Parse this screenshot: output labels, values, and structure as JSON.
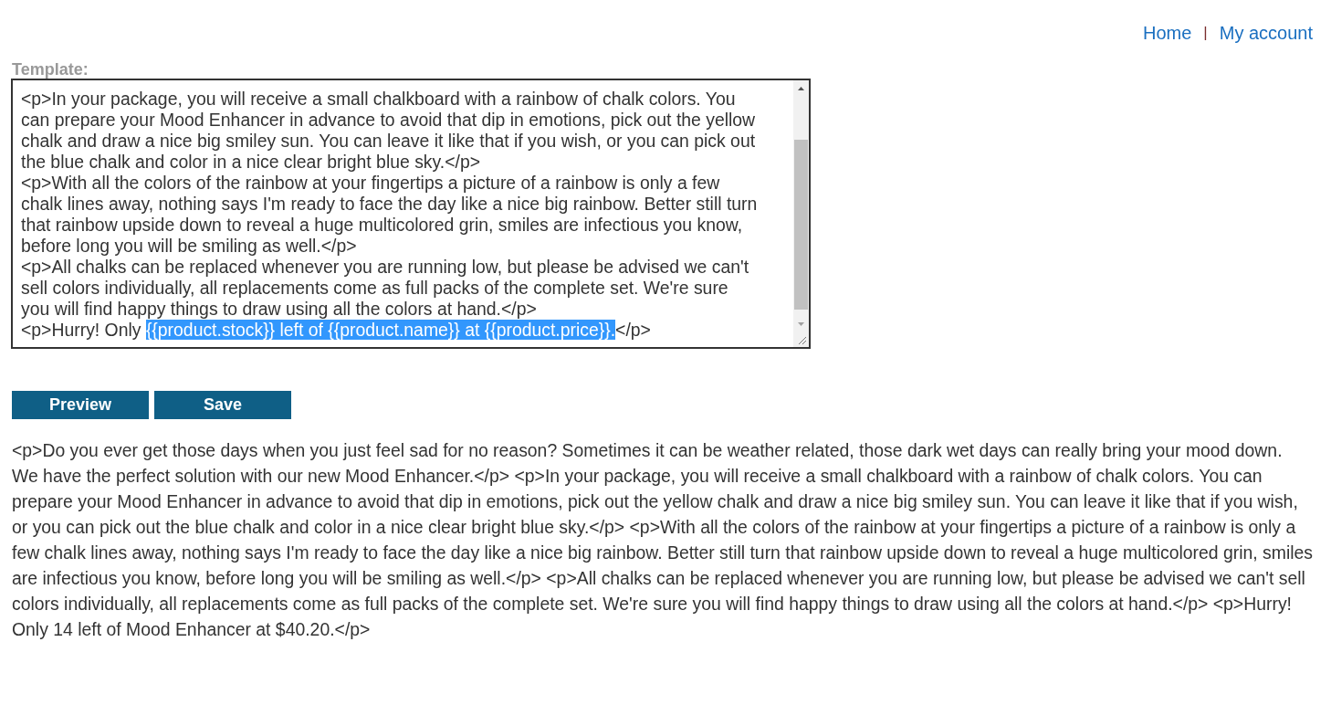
{
  "nav": [
    {
      "label": "Home"
    },
    {
      "label": "My account"
    }
  ],
  "nav_separator": "|",
  "template": {
    "label": "Template:",
    "lines": [
      [
        {
          "text": "<p>In your package, you will receive a small chalkboard with a rainbow of chalk colors. You",
          "selected": false
        }
      ],
      [
        {
          "text": "can prepare your Mood Enhancer in advance to avoid that dip in emotions, pick out the yellow",
          "selected": false
        }
      ],
      [
        {
          "text": "chalk and draw a nice big smiley sun. You can leave it like that if you wish, or you can pick out",
          "selected": false
        }
      ],
      [
        {
          "text": "the blue chalk and color in a nice clear bright blue sky.</p>",
          "selected": false
        }
      ],
      [
        {
          "text": "<p>With all the colors of the rainbow at your fingertips a picture of a rainbow is only a few",
          "selected": false
        }
      ],
      [
        {
          "text": "chalk lines away, nothing says I'm ready to face the day like a nice big rainbow. Better still turn",
          "selected": false
        }
      ],
      [
        {
          "text": "that rainbow upside down to reveal a huge multicolored grin, smiles are infectious you know,",
          "selected": false
        }
      ],
      [
        {
          "text": "before long you will be smiling as well.</p>",
          "selected": false
        }
      ],
      [
        {
          "text": "<p>All chalks can be replaced whenever you are running low, but please be advised we can't",
          "selected": false
        }
      ],
      [
        {
          "text": "sell colors individually, all replacements come as full packs of the complete set. We're sure",
          "selected": false
        }
      ],
      [
        {
          "text": "you will find happy things to draw using all the colors at hand.</p>",
          "selected": false
        }
      ],
      [
        {
          "text": "<p>Hurry! Only ",
          "selected": false
        },
        {
          "text": "{{product.stock}} left of {{product.name}} at {{product.price}}.",
          "selected": true
        },
        {
          "text": "</p>",
          "selected": false
        }
      ]
    ]
  },
  "buttons": [
    {
      "label": "Preview"
    },
    {
      "label": "Save"
    }
  ],
  "preview": "<p>Do you ever get those days when you just feel sad for no reason? Sometimes it can be weather related, those dark wet days can really bring your mood down. We have the perfect solution with our new Mood Enhancer.</p> <p>In your package, you will receive a small chalkboard with a rainbow of chalk colors. You can prepare your Mood Enhancer in advance to avoid that dip in emotions, pick out the yellow chalk and draw a nice big smiley sun. You can leave it like that if you wish, or you can pick out the blue chalk and color in a nice clear bright blue sky.</p> <p>With all the colors of the rainbow at your fingertips a picture of a rainbow is only a few chalk lines away, nothing says I'm ready to face the day like a nice big rainbow. Better still turn that rainbow upside down to reveal a huge multicolored grin, smiles are infectious you know, before long you will be smiling as well.</p> <p>All chalks can be replaced whenever you are running low, but please be advised we can't sell colors individually, all replacements come as full packs of the complete set. We're sure you will find happy things to draw using all the colors at hand.</p> <p>Hurry! Only 14 left of Mood Enhancer at $40.20.</p>"
}
